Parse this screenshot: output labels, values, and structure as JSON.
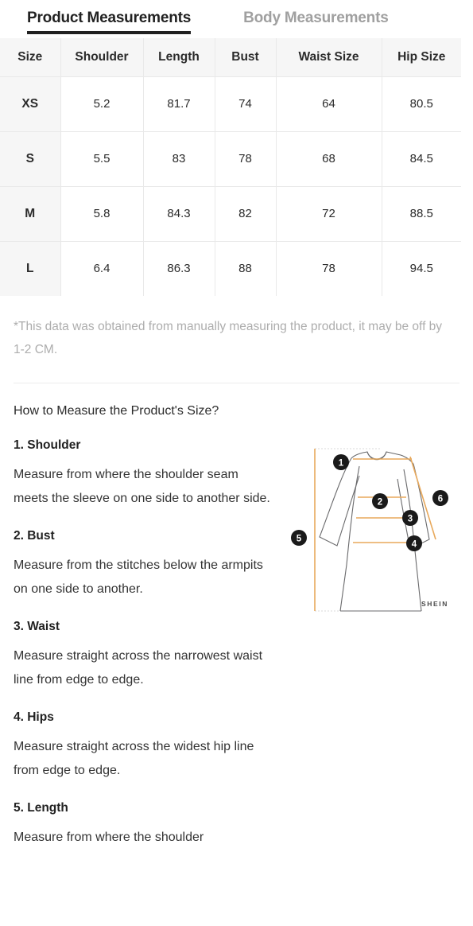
{
  "tabs": [
    {
      "id": "product",
      "label": "Product Measurements",
      "active": true
    },
    {
      "id": "body",
      "label": "Body Measurements",
      "active": false
    }
  ],
  "table": {
    "headers": [
      "Size",
      "Shoulder",
      "Length",
      "Bust",
      "Waist Size",
      "Hip Size"
    ],
    "rows": [
      {
        "size": "XS",
        "shoulder": "5.2",
        "length": "81.7",
        "bust": "74",
        "waist": "64",
        "hip": "80.5"
      },
      {
        "size": "S",
        "shoulder": "5.5",
        "length": "83",
        "bust": "78",
        "waist": "68",
        "hip": "84.5"
      },
      {
        "size": "M",
        "shoulder": "5.8",
        "length": "84.3",
        "bust": "82",
        "waist": "72",
        "hip": "88.5"
      },
      {
        "size": "L",
        "shoulder": "6.4",
        "length": "86.3",
        "bust": "88",
        "waist": "78",
        "hip": "94.5"
      }
    ]
  },
  "disclaimer": "*This data was obtained from manually measuring the product, it may be off by 1-2 CM.",
  "how_to_measure": {
    "title": "How to Measure the Product's Size?",
    "steps": [
      {
        "title": "1. Shoulder",
        "body": "Measure from where the shoulder seam meets the sleeve on one side to another side."
      },
      {
        "title": "2. Bust",
        "body": "Measure from the stitches below the armpits on one side to another."
      },
      {
        "title": "3. Waist",
        "body": "Measure straight across the narrowest waist line from edge to edge."
      },
      {
        "title": "4. Hips",
        "body": "Measure straight across the widest hip line from edge to edge."
      },
      {
        "title": "5. Length",
        "body": "Measure from where the shoulder"
      }
    ]
  },
  "diagram": {
    "brand": "SHEIN",
    "markers": [
      "1",
      "2",
      "3",
      "4",
      "5",
      "6"
    ],
    "accent_color": "#e8a95c",
    "outline_color": "#58585a",
    "marker_color": "#1a1a1a"
  },
  "colors": {
    "active_tab": "#222222",
    "inactive_tab": "#a0a0a0",
    "table_header_bg": "#f6f6f6",
    "table_border": "#e9e9e9",
    "disclaimer_text": "#adadad"
  }
}
